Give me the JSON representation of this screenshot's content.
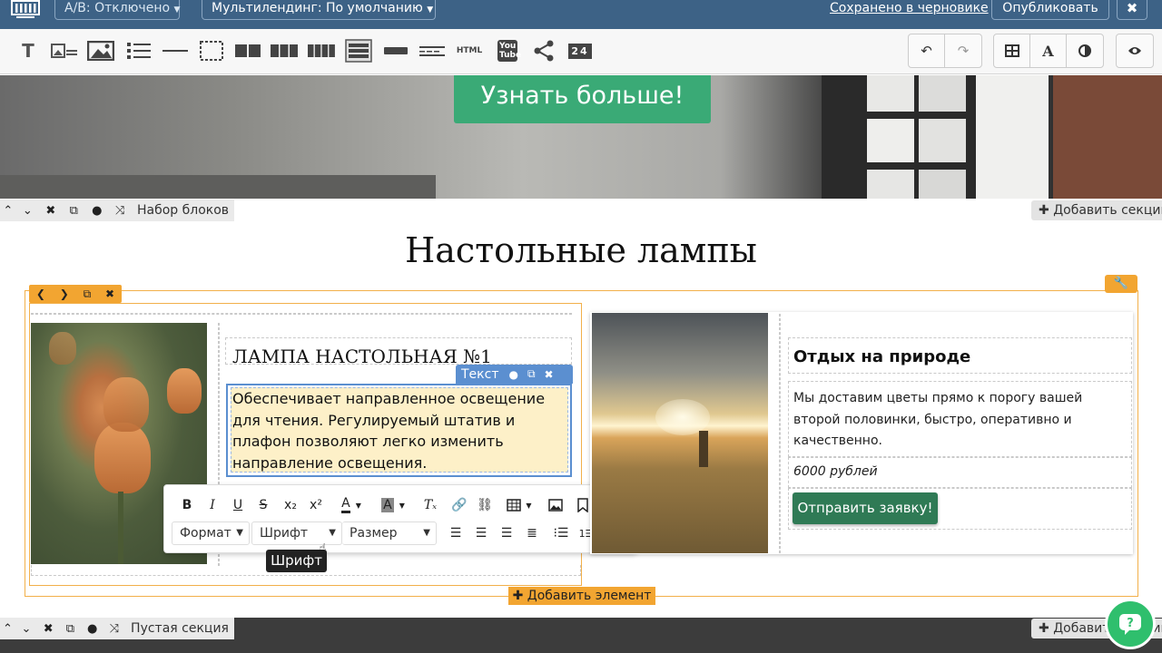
{
  "topbar": {
    "ab_label": "А/В: Отключено",
    "multilanding_label": "Мультилендинг: По умолчанию",
    "saved_label": "Сохранено в черновике",
    "publish_label": "Опубликовать",
    "close_glyph": "✖"
  },
  "toolbar": {
    "tools": [
      {
        "icon": "text-icon",
        "glyph": "T"
      },
      {
        "icon": "image-text-icon"
      },
      {
        "icon": "image-icon"
      },
      {
        "icon": "list-icon"
      },
      {
        "icon": "divider-icon"
      },
      {
        "icon": "empty-block-icon"
      },
      {
        "icon": "two-columns-icon"
      },
      {
        "icon": "three-columns-icon"
      },
      {
        "icon": "four-columns-icon"
      },
      {
        "icon": "form-icon"
      },
      {
        "icon": "button-icon"
      },
      {
        "icon": "spacer-icon"
      },
      {
        "icon": "html-icon",
        "glyph": "HTML"
      },
      {
        "icon": "youtube-icon",
        "glyph": "You Tube"
      },
      {
        "icon": "share-icon"
      },
      {
        "icon": "counter-icon",
        "glyph": "24"
      }
    ],
    "right": [
      "undo-icon",
      "redo-icon",
      "layout-icon",
      "font-icon",
      "contrast-icon",
      "preview-eye-icon"
    ],
    "font_glyph": "A"
  },
  "hero": {
    "button_label": "Узнать больше!"
  },
  "section1": {
    "controls_label": "Набор блоков",
    "add_section_label": "Добавить секцию",
    "title": "Настольные лампы"
  },
  "card1": {
    "title": "ЛАМПА НАСТОЛЬНАЯ №1",
    "text_tag": "Текст",
    "body": "Обеспечивает направленное освещение для чтения. Регулируемый штатив и плафон позволяют легко изменить направление освещения."
  },
  "editor": {
    "format_label": "Формат",
    "font_label": "Шрифт",
    "size_label": "Размер",
    "tooltip": "Шрифт",
    "bold": "B",
    "italic": "I",
    "underline": "U",
    "strike": "S",
    "color": "A"
  },
  "card2": {
    "title": "Отдых на природе",
    "description": "Мы доставим цветы прямо к порогу вашей второй половинки, быстро, оперативно и качественно.",
    "price": "6000 рублей",
    "button_label": "Отправить заявку!"
  },
  "add_element_label": "Добавить элемент",
  "section2": {
    "controls_label": "Пустая секция",
    "add_section_label": "Добавить секцию"
  },
  "colors": {
    "topbar": "#3d6286",
    "accent_orange": "#f2a531",
    "hero_button": "#3aaa76",
    "order_button": "#2f7a55",
    "text_tag": "#5b8fd0",
    "chat": "#2fbf6d"
  }
}
